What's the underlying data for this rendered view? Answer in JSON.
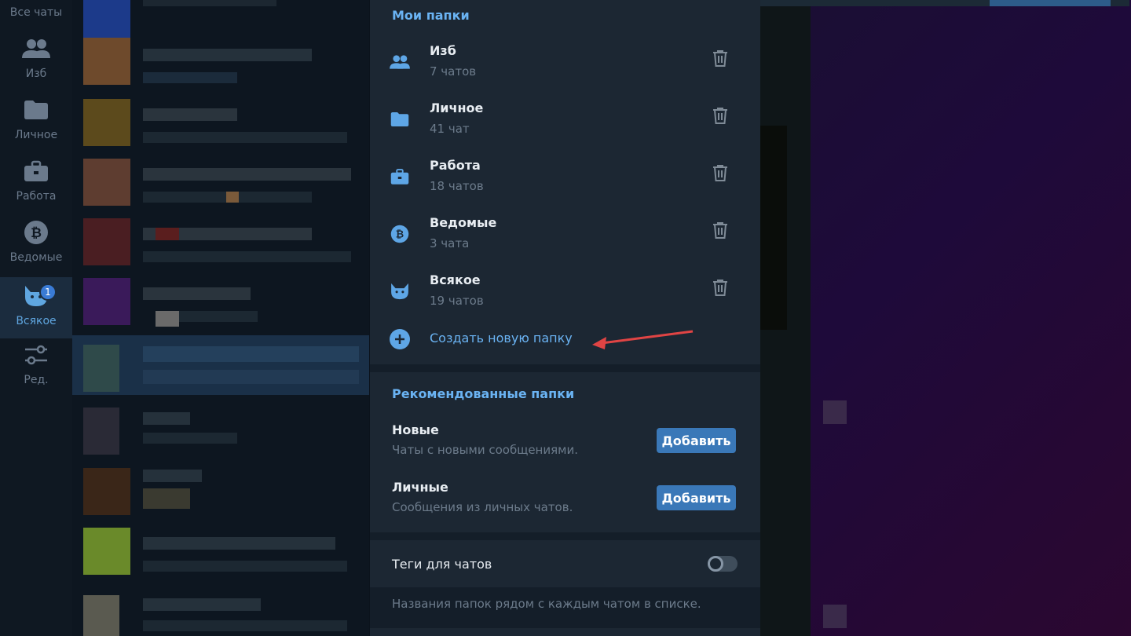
{
  "rail": {
    "items": [
      {
        "label": "Все чаты",
        "icon": "chats-icon"
      },
      {
        "label": "Изб",
        "icon": "users-icon"
      },
      {
        "label": "Личное",
        "icon": "folder-icon"
      },
      {
        "label": "Работа",
        "icon": "briefcase-icon"
      },
      {
        "label": "Ведомые",
        "icon": "bitcoin-icon"
      },
      {
        "label": "Всякое",
        "icon": "cat-icon",
        "badge": "1",
        "active": true
      },
      {
        "label": "Ред.",
        "icon": "sliders-icon"
      }
    ]
  },
  "panel": {
    "my_folders_title": "Мои папки",
    "folders": [
      {
        "name": "Изб",
        "count": "7 чатов",
        "icon": "users-icon"
      },
      {
        "name": "Личное",
        "count": "41 чат",
        "icon": "folder-icon"
      },
      {
        "name": "Работа",
        "count": "18 чатов",
        "icon": "briefcase-icon"
      },
      {
        "name": "Ведомые",
        "count": "3 чата",
        "icon": "bitcoin-icon"
      },
      {
        "name": "Всякое",
        "count": "19 чатов",
        "icon": "cat-icon"
      }
    ],
    "create_label": "Создать новую папку",
    "recommended_title": "Рекомендованные папки",
    "recommended": [
      {
        "name": "Новые",
        "desc": "Чаты с новыми сообщениями.",
        "button": "Добавить"
      },
      {
        "name": "Личные",
        "desc": "Сообщения из личных чатов.",
        "button": "Добавить"
      }
    ],
    "tags_label": "Теги для чатов",
    "tags_enabled": false,
    "tags_hint": "Названия папок рядом с каждым чатом в списке."
  },
  "colors": {
    "accent": "#6ab3f3",
    "button": "#3a78b8",
    "annotation_arrow": "#e04444"
  }
}
